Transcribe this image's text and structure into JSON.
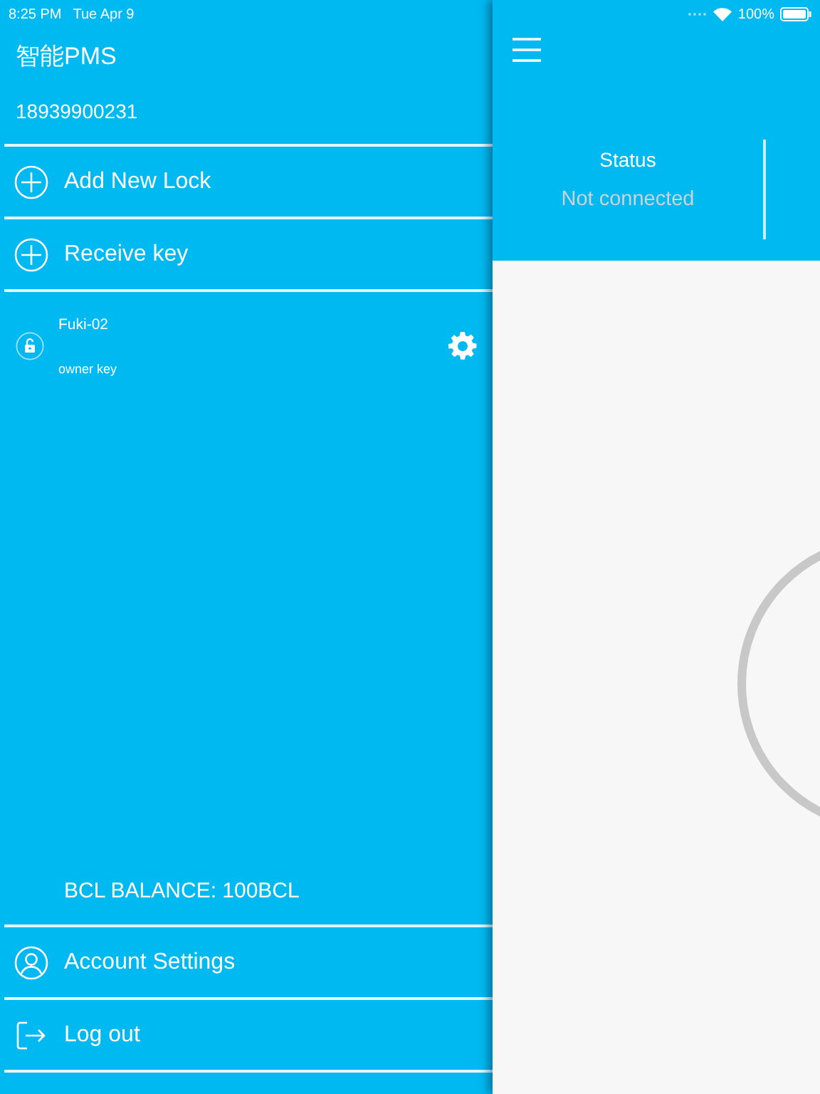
{
  "status_bar": {
    "time": "8:25 PM",
    "date": "Tue Apr 9",
    "battery": "100%"
  },
  "drawer": {
    "title": "智能PMS",
    "phone": "18939900231",
    "actions": [
      {
        "label": "Add New Lock",
        "kind": "add"
      },
      {
        "label": "Receive key",
        "kind": "add"
      }
    ],
    "locks": [
      {
        "name": "Fuki-02",
        "role": "owner key"
      }
    ],
    "balance": "BCL BALANCE: 100BCL",
    "footer": [
      {
        "label": "Account Settings",
        "kind": "account"
      },
      {
        "label": "Log out",
        "kind": "logout"
      }
    ]
  },
  "main": {
    "status_label": "Status",
    "status_value": "Not connected"
  }
}
